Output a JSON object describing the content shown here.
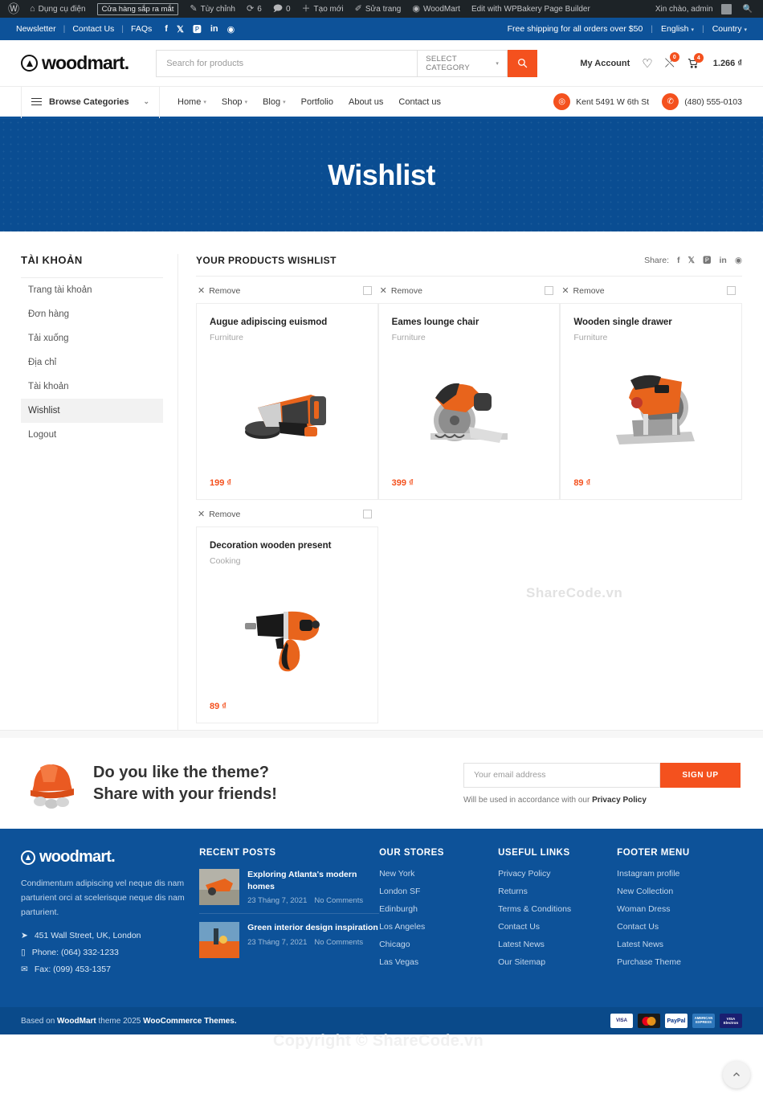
{
  "adminbar": {
    "logo_icon": "wordpress-icon",
    "items": [
      {
        "label": "Dụng cụ điện",
        "icon": "dashboard-icon"
      },
      {
        "label": "Cửa hàng sắp ra mắt",
        "icon": "chip"
      },
      {
        "label": "Tùy chỉnh",
        "icon": "pencil-icon"
      },
      {
        "label": "6",
        "icon": "updates-icon"
      },
      {
        "label": "0",
        "icon": "comment-icon"
      },
      {
        "label": "Tạo mới",
        "icon": "plus-icon"
      },
      {
        "label": "Sửa trang",
        "icon": "edit-icon"
      },
      {
        "label": "WoodMart",
        "icon": "woodmart-icon"
      },
      {
        "label": "Edit with WPBakery Page Builder",
        "icon": "none"
      }
    ],
    "greeting": "Xin chào, admin",
    "search_icon": "search-icon"
  },
  "topbar": {
    "links": [
      "Newsletter",
      "Contact Us",
      "FAQs"
    ],
    "social": [
      "facebook-icon",
      "x-twitter-icon",
      "pinterest-icon",
      "linkedin-icon",
      "telegram-icon"
    ],
    "shipping_note": "Free shipping for all orders over $50",
    "language": "English",
    "country": "Country"
  },
  "header": {
    "brand": "woodmart.",
    "search_placeholder": "Search for products",
    "category_label": "SELECT CATEGORY",
    "search_icon": "search-icon",
    "my_account": "My Account",
    "wishlist_icon": "heart-icon",
    "compare_icon": "compare-icon",
    "compare_count": "0",
    "cart_icon": "cart-icon",
    "cart_count": "4",
    "cart_total": "1.266 ₫"
  },
  "nav": {
    "browse_label": "Browse Categories",
    "menu": [
      {
        "label": "Home",
        "has_caret": true
      },
      {
        "label": "Shop",
        "has_caret": true
      },
      {
        "label": "Blog",
        "has_caret": true
      },
      {
        "label": "Portfolio",
        "has_caret": false
      },
      {
        "label": "About us",
        "has_caret": false
      },
      {
        "label": "Contact us",
        "has_caret": false
      }
    ],
    "address": "Kent 5491 W 6th St",
    "address_icon": "map-pin-icon",
    "phone": "(480) 555-0103",
    "phone_icon": "phone-icon"
  },
  "banner": {
    "title": "Wishlist"
  },
  "sidebar": {
    "title": "TÀI KHOẢN",
    "items": [
      {
        "label": "Trang tài khoản",
        "active": false
      },
      {
        "label": "Đơn hàng",
        "active": false
      },
      {
        "label": "Tải xuống",
        "active": false
      },
      {
        "label": "Địa chỉ",
        "active": false
      },
      {
        "label": "Tài khoản",
        "active": false
      },
      {
        "label": "Wishlist",
        "active": true
      },
      {
        "label": "Logout",
        "active": false
      }
    ]
  },
  "wishlist": {
    "heading": "YOUR PRODUCTS WISHLIST",
    "share_label": "Share:",
    "share_icons": [
      "facebook-icon",
      "x-twitter-icon",
      "pinterest-icon",
      "linkedin-icon",
      "telegram-icon"
    ],
    "remove_label": "Remove",
    "products": [
      {
        "name": "Augue adipiscing euismod",
        "category": "Furniture",
        "price": "199 ₫",
        "image": "angle-grinder"
      },
      {
        "name": "Eames lounge chair",
        "category": "Furniture",
        "price": "399 ₫",
        "image": "circular-saw"
      },
      {
        "name": "Wooden single drawer",
        "category": "Furniture",
        "price": "89 ₫",
        "image": "chop-saw"
      },
      {
        "name": "Decoration wooden present",
        "category": "Cooking",
        "price": "89 ₫",
        "image": "impact-wrench"
      }
    ],
    "watermark": "ShareCode.vn"
  },
  "newsletter": {
    "line1": "Do you like the theme?",
    "line2": "Share with your friends!",
    "email_placeholder": "Your email address",
    "button": "SIGN UP",
    "note_prefix": "Will be used in accordance with our ",
    "note_link": "Privacy Policy",
    "helmet_icon": "helmet-icon"
  },
  "footer": {
    "brand": "woodmart.",
    "description": "Condimentum adipiscing vel neque dis nam parturient orci at scelerisque neque dis nam parturient.",
    "contacts": [
      {
        "icon": "location-arrow-icon",
        "text": "451 Wall Street, UK, London"
      },
      {
        "icon": "mobile-icon",
        "text": "Phone: (064) 332-1233"
      },
      {
        "icon": "envelope-icon",
        "text": "Fax: (099) 453-1357"
      }
    ],
    "recent_posts_title": "RECENT POSTS",
    "posts": [
      {
        "title": "Exploring Atlanta's modern homes",
        "date": "23 Tháng 7, 2021",
        "comments": "No Comments"
      },
      {
        "title": "Green interior design inspiration",
        "date": "23 Tháng 7, 2021",
        "comments": "No Comments"
      }
    ],
    "stores_title": "OUR STORES",
    "stores": [
      "New York",
      "London SF",
      "Edinburgh",
      "Los Angeles",
      "Chicago",
      "Las Vegas"
    ],
    "useful_title": "USEFUL LINKS",
    "useful": [
      "Privacy Policy",
      "Returns",
      "Terms & Conditions",
      "Contact Us",
      "Latest News",
      "Our Sitemap"
    ],
    "menu_title": "FOOTER MENU",
    "menu": [
      "Instagram profile",
      "New Collection",
      "Woman Dress",
      "Contact Us",
      "Latest News",
      "Purchase Theme"
    ],
    "copyright_prefix": "Based on ",
    "copyright_brand": "WoodMart",
    "copyright_mid": " theme 2025 ",
    "copyright_suffix": "WooCommerce Themes.",
    "payments": [
      "VISA",
      "MasterCard",
      "PayPal",
      "AMERICAN EXPRESS",
      "VISA Electron"
    ],
    "scroll_top_icon": "chevron-up-icon",
    "watermark": "Copyright © ShareCode.vn"
  },
  "colors": {
    "accent": "#f4511e",
    "brand_blue": "#0d5299",
    "banner_blue": "#0a4d92",
    "admin_dark": "#1d2327"
  }
}
